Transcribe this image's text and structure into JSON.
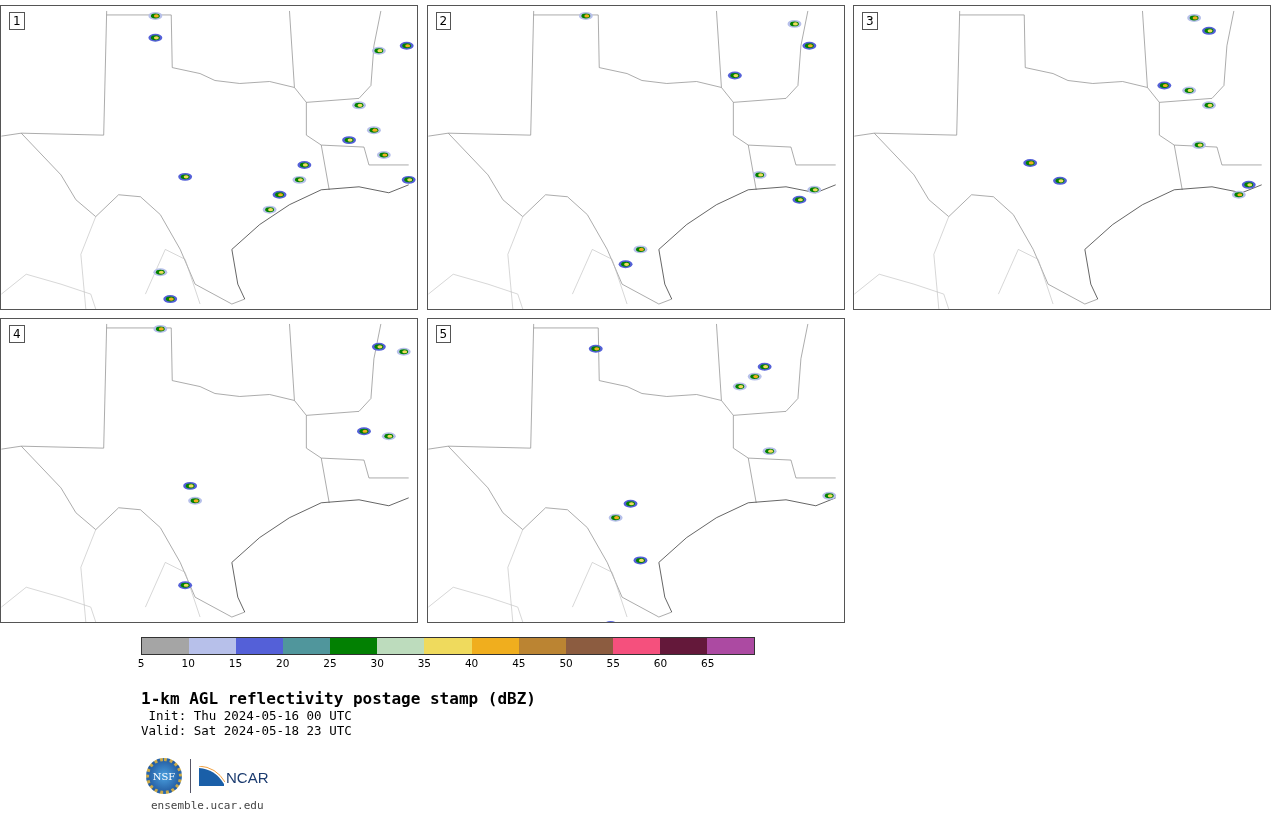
{
  "panels": [
    {
      "label": "1"
    },
    {
      "label": "2"
    },
    {
      "label": "3"
    },
    {
      "label": "4"
    },
    {
      "label": "5"
    }
  ],
  "colorbar": {
    "bins": [
      {
        "color": "#a5a5a5"
      },
      {
        "color": "#b7c0ea"
      },
      {
        "color": "#5460d8"
      },
      {
        "color": "#50969c"
      },
      {
        "color": "#028002"
      },
      {
        "color": "#bddcbd"
      },
      {
        "color": "#efda5d"
      },
      {
        "color": "#f0ae1e"
      },
      {
        "color": "#bb8432"
      },
      {
        "color": "#8c5c40"
      },
      {
        "color": "#f5507d"
      },
      {
        "color": "#64183a"
      },
      {
        "color": "#ac4aa2"
      }
    ],
    "ticks": [
      "5",
      "10",
      "15",
      "20",
      "25",
      "30",
      "35",
      "40",
      "45",
      "50",
      "55",
      "60",
      "65"
    ]
  },
  "title": "1-km AGL reflectivity postage stamp (dBZ)",
  "init": " Init: Thu 2024-05-16 00 UTC",
  "valid": "Valid: Sat 2024-05-18 23 UTC",
  "logos": {
    "nsf_text": "NSF",
    "ncar_text": "NCAR"
  },
  "link": "ensemble.ucar.edu"
}
